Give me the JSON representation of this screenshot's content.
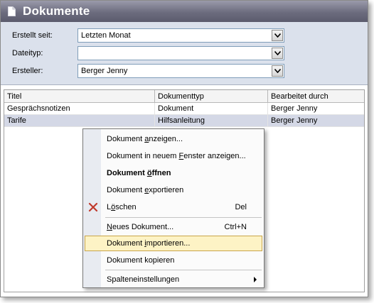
{
  "window": {
    "title": "Dokumente"
  },
  "filters": [
    {
      "label": "Erstellt seit:",
      "value": "Letzten Monat"
    },
    {
      "label": "Dateityp:",
      "value": ""
    },
    {
      "label": "Ersteller:",
      "value": "Berger Jenny"
    }
  ],
  "grid": {
    "columns": [
      "Titel",
      "Dokumenttyp",
      "Bearbeitet durch"
    ],
    "rows": [
      [
        "Gesprächsnotizen",
        "Dokument",
        "Berger Jenny"
      ],
      [
        "Tarife",
        "Hilfsanleitung",
        "Berger Jenny"
      ]
    ],
    "selected_row": 1
  },
  "context_menu": {
    "items": [
      {
        "label_pre": "Dokument ",
        "label_ul": "a",
        "label_post": "nzeigen...",
        "shortcut": ""
      },
      {
        "label_pre": "Dokument in neuem ",
        "label_ul": "F",
        "label_post": "enster anzeigen...",
        "shortcut": ""
      },
      {
        "label_pre": "Dokument ",
        "label_ul": "ö",
        "label_post": "ffnen",
        "shortcut": ""
      },
      {
        "label_pre": "Dokument ",
        "label_ul": "e",
        "label_post": "xportieren",
        "shortcut": ""
      },
      {
        "label_pre": "L",
        "label_ul": "ö",
        "label_post": "schen",
        "shortcut": "Del"
      },
      {
        "label_pre": "",
        "label_ul": "N",
        "label_post": "eues Dokument...",
        "shortcut": "Ctrl+N"
      },
      {
        "label_pre": "Dokument ",
        "label_ul": "i",
        "label_post": "mportieren...",
        "shortcut": ""
      },
      {
        "label_pre": "Dokument kopieren",
        "label_ul": "",
        "label_post": "",
        "shortcut": ""
      },
      {
        "label_pre": "Spalteneinstellungen",
        "label_ul": "",
        "label_post": "",
        "shortcut": ""
      }
    ],
    "highlight_color": "#fdf3c5",
    "delete_icon_color": "#c0392b"
  },
  "colors": {
    "titlebar": "#6c6c7e",
    "filter_panel": "#dbe1ec",
    "selected_row": "#d4d8e6"
  }
}
